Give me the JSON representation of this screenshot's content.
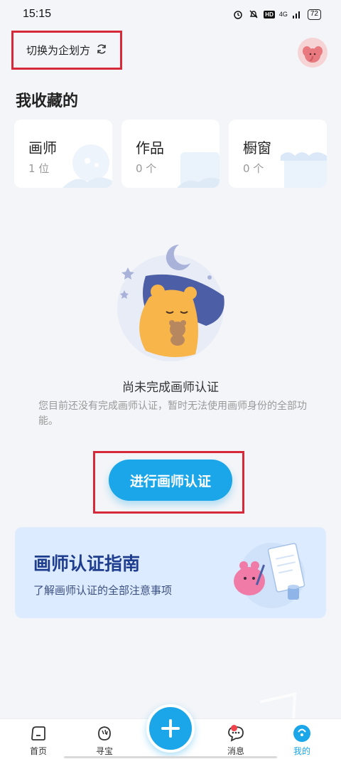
{
  "status_bar": {
    "time": "15:15",
    "hd": "HD",
    "network": "4G",
    "battery": "72"
  },
  "header": {
    "switch_label": "切换为企划方"
  },
  "favorites": {
    "title": "我收藏的",
    "cards": [
      {
        "name": "画师",
        "count": "1 位"
      },
      {
        "name": "作品",
        "count": "0 个"
      },
      {
        "name": "橱窗",
        "count": "0 个"
      }
    ]
  },
  "empty_state": {
    "title": "尚未完成画师认证",
    "description": "您目前还没有完成画师认证，暂时无法使用画师身份的全部功能。",
    "button_label": "进行画师认证"
  },
  "guide": {
    "title": "画师认证指南",
    "subtitle": "了解画师认证的全部注意事项"
  },
  "tab_bar": {
    "items": [
      {
        "label": "首页"
      },
      {
        "label": "寻宝"
      },
      {
        "label": "消息"
      },
      {
        "label": "我的"
      }
    ],
    "fab_icon": "plus-icon"
  },
  "colors": {
    "accent": "#1aa6e8",
    "highlight_border": "#d62a3a",
    "guide_title": "#1e3d8f"
  }
}
